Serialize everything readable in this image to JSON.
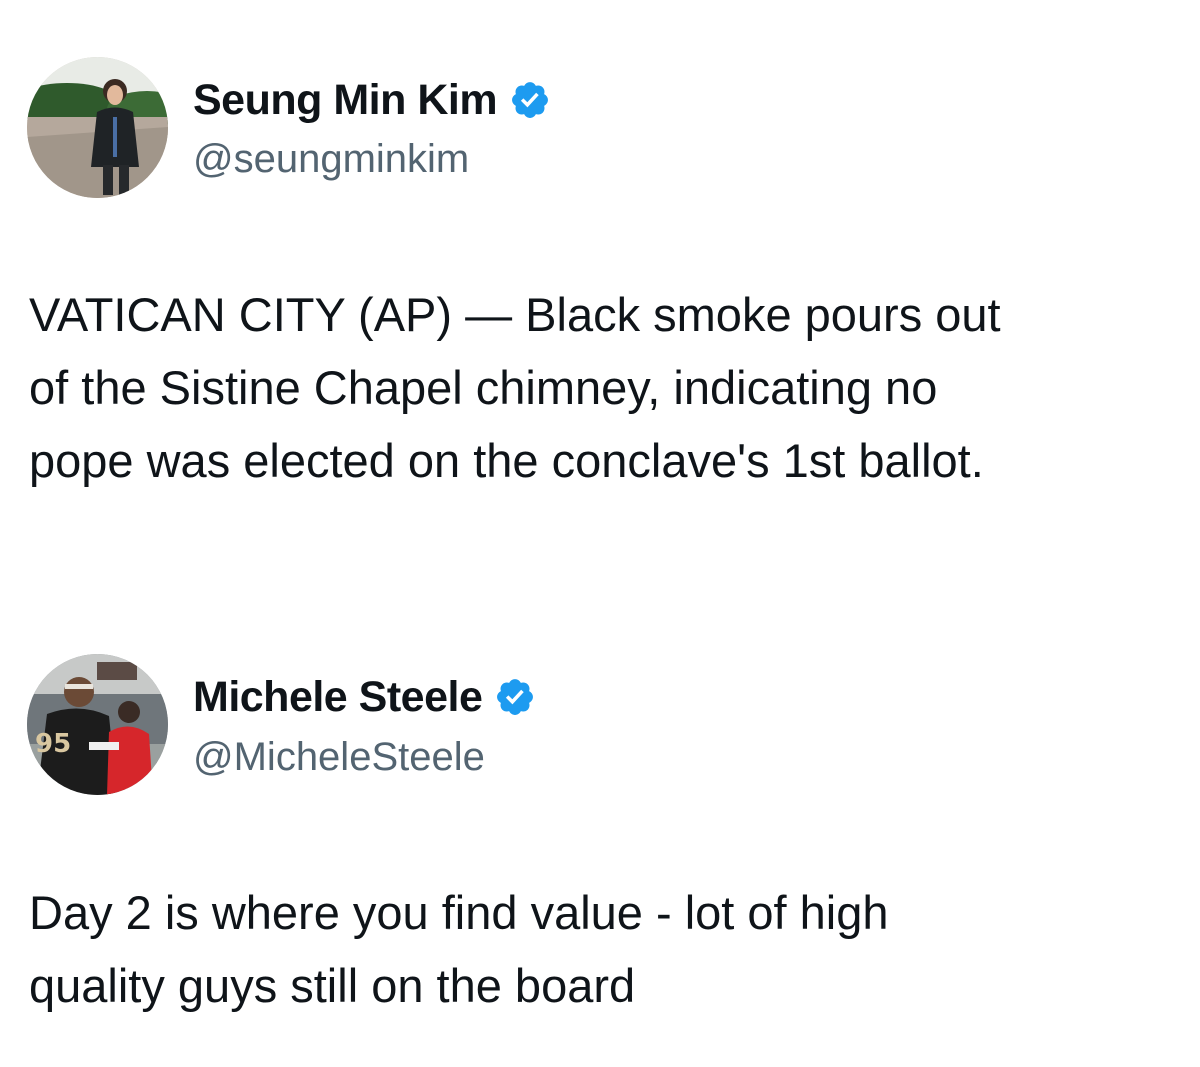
{
  "tweets": [
    {
      "display_name": "Seung Min Kim",
      "handle": "@seungminkim",
      "verified": true,
      "avatar_icon": "profile-photo-icon",
      "text": "VATICAN CITY (AP) — Black smoke pours out\nof the Sistine Chapel chimney, indicating no\npope was elected on the conclave's 1st ballot."
    },
    {
      "display_name": "Michele Steele",
      "handle": "@MicheleSteele",
      "verified": true,
      "avatar_icon": "profile-photo-icon",
      "text": "Day 2 is where you find value -  lot of high\nquality guys still on the board"
    }
  ],
  "colors": {
    "verified_badge": "#1d9bf0",
    "name": "#0f1419",
    "handle": "#536471",
    "background": "#ffffff"
  }
}
